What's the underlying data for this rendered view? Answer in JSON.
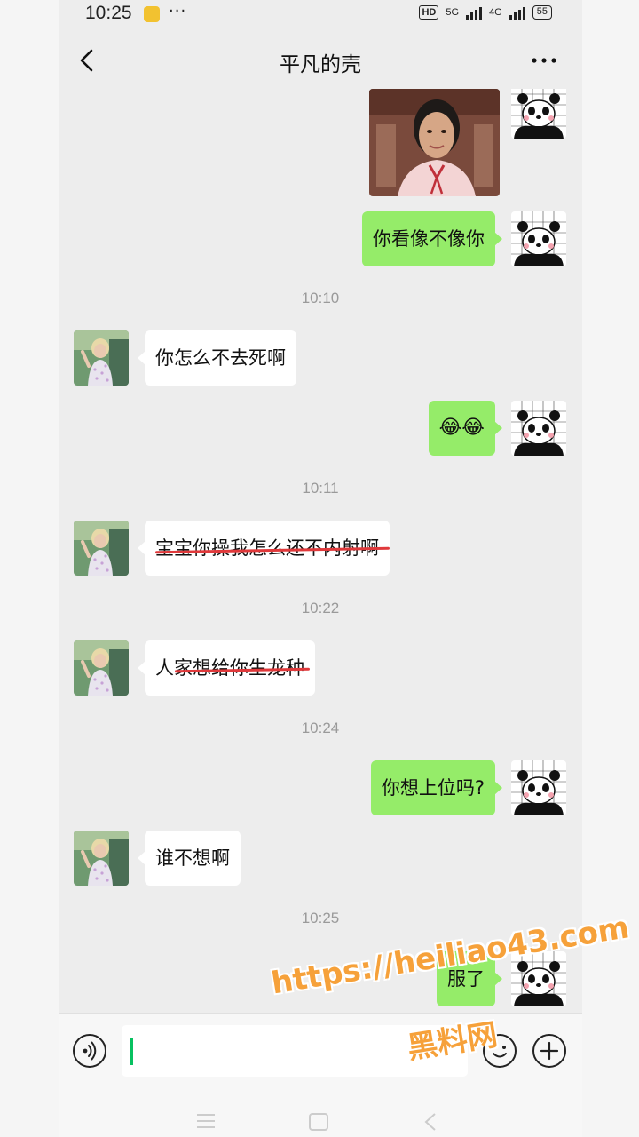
{
  "status_bar": {
    "time": "10:25",
    "dots": "···",
    "hd": "HD",
    "net1": "5G",
    "net2": "4G",
    "battery": "55"
  },
  "header": {
    "title": "平凡的壳"
  },
  "messages": [
    {
      "kind": "image",
      "from": "me"
    },
    {
      "kind": "text",
      "from": "me",
      "text": "你看像不像你"
    },
    {
      "kind": "time",
      "text": "10:10"
    },
    {
      "kind": "text",
      "from": "them",
      "text": "你怎么不去死啊"
    },
    {
      "kind": "text",
      "from": "me",
      "text": "😂😂"
    },
    {
      "kind": "time",
      "text": "10:11"
    },
    {
      "kind": "text",
      "from": "them",
      "text": "宝宝你操我怎么还不内射啊",
      "strikethrough": true
    },
    {
      "kind": "time",
      "text": "10:22"
    },
    {
      "kind": "text",
      "from": "them",
      "text": "人家想给你生龙种",
      "strikethrough": true
    },
    {
      "kind": "time",
      "text": "10:24"
    },
    {
      "kind": "text",
      "from": "me",
      "text": "你想上位吗?"
    },
    {
      "kind": "text",
      "from": "them",
      "text": "谁不想啊"
    },
    {
      "kind": "time",
      "text": "10:25"
    },
    {
      "kind": "text",
      "from": "me",
      "text": "服了"
    }
  ],
  "watermark": {
    "url": "https://heiliao43.com",
    "name": "黑料网"
  },
  "colors": {
    "my_bubble": "#95ec69",
    "their_bubble": "#ffffff",
    "chat_bg": "#ededed",
    "strike": "#e0393b",
    "watermark": "#f6a13a"
  }
}
